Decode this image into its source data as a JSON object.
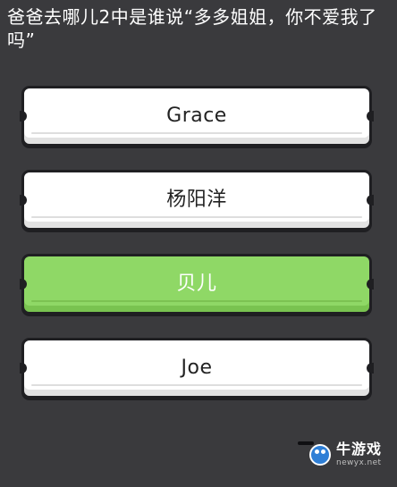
{
  "question": "爸爸去哪儿2中是谁说“多多姐姐，你不爱我了吗”",
  "answers": [
    {
      "label": "Grace",
      "selected": false
    },
    {
      "label": "杨阳洋",
      "selected": false
    },
    {
      "label": "贝儿",
      "selected": true
    },
    {
      "label": "Joe",
      "selected": false
    }
  ],
  "watermark": {
    "brand": "牛游戏",
    "url": "newyx.net"
  }
}
